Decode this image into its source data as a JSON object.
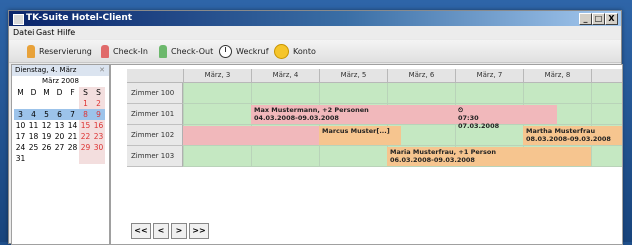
{
  "window": {
    "title": "TK-Suite Hotel-Client",
    "minimize_label": "_",
    "maximize_label": "□",
    "close_label": "X"
  },
  "menu": [
    "Datei",
    "Gast",
    "Hilfe"
  ],
  "toolbar": {
    "reservierung": "Reservierung",
    "checkin": "Check-In",
    "checkout": "Check-Out",
    "weckruf": "Weckruf",
    "konto": "Konto"
  },
  "colors": {
    "available": "#c5e8c2",
    "reserved": "#f1b8bb",
    "occupied": "#f6c58f"
  },
  "sidebar": {
    "date_header": "Dienstag, 4. März",
    "month_title": "März 2008",
    "weekday_headers": [
      "M",
      "D",
      "M",
      "D",
      "F",
      "S",
      "S"
    ],
    "weeks": [
      [
        "",
        "",
        "",
        "",
        "",
        "1",
        "2"
      ],
      [
        "3",
        "4",
        "5",
        "6",
        "7",
        "8",
        "9"
      ],
      [
        "10",
        "11",
        "12",
        "13",
        "14",
        "15",
        "16"
      ],
      [
        "17",
        "18",
        "19",
        "20",
        "21",
        "22",
        "23"
      ],
      [
        "24",
        "25",
        "26",
        "27",
        "28",
        "29",
        "30"
      ],
      [
        "31",
        "",
        "",
        "",
        "",
        "",
        ""
      ]
    ]
  },
  "planner": {
    "columns": [
      "März, 3",
      "März, 4",
      "März, 5",
      "März, 6",
      "März, 7",
      "März, 8",
      "M"
    ],
    "rooms": [
      "Zimmer 100",
      "Zimmer 101",
      "Zimmer 102",
      "Zimmer 103"
    ],
    "bookings": [
      {
        "room": "Zimmer 101",
        "line1": "Max Mustermann, +2 Personen",
        "line2": "04.03.2008-09.03.2008"
      },
      {
        "room": "Zimmer 101",
        "line1": "07:30",
        "line2": "07.03.2008"
      },
      {
        "room": "Zimmer 102",
        "line1": "Marcus Muster[...]",
        "line2": ""
      },
      {
        "room": "Zimmer 102",
        "line1": "Martha Musterfrau",
        "line2": "08.03.2008-09.03.2008"
      },
      {
        "room": "Zimmer 103",
        "line1": "Maria Musterfrau, +1 Person",
        "line2": "06.03.2008-09.03.2008"
      }
    ]
  },
  "nav": {
    "first": "<<",
    "prev": "<",
    "next": ">",
    "last": ">>"
  }
}
